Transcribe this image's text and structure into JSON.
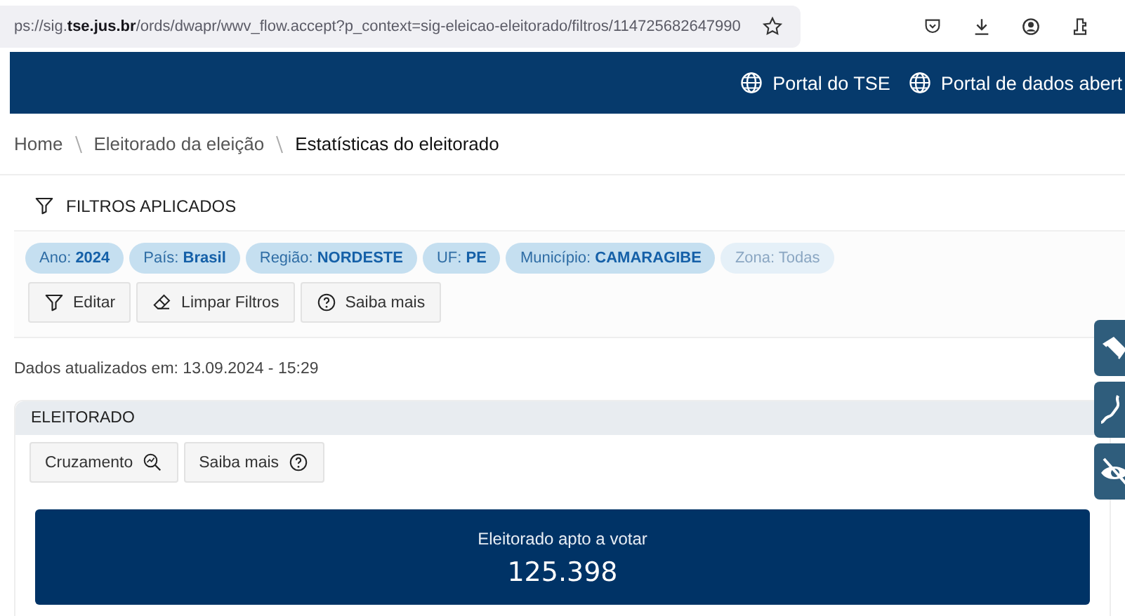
{
  "browser": {
    "url": "ps://sig.**tse.jus.br**/ords/dwapr/wwv_flow.accept?p_context=sig-eleicao-eleitorado/filtros/114725682647990"
  },
  "header": {
    "links": [
      "Portal do TSE",
      "Portal de dados abert"
    ]
  },
  "breadcrumb": [
    {
      "label": "Home",
      "current": false
    },
    {
      "label": "Eleitorado da eleição",
      "current": false
    },
    {
      "label": "Estatísticas do eleitorado",
      "current": true
    }
  ],
  "filters": {
    "title": "FILTROS APLICADOS",
    "chips": [
      {
        "text": "Ano: **2024**",
        "applied": true
      },
      {
        "text": "País: **Brasil**",
        "applied": true
      },
      {
        "text": "Região: **NORDESTE**",
        "applied": true
      },
      {
        "text": "UF: **PE**",
        "applied": true
      },
      {
        "text": "Município: **CAMARAGIBE**",
        "applied": true
      },
      {
        "text": "Zona: Todas",
        "applied": false
      }
    ],
    "buttons": [
      {
        "kind": "filter",
        "label": "Editar"
      },
      {
        "kind": "eraser",
        "label": "Limpar Filtros"
      },
      {
        "kind": "help",
        "label": "Saiba mais"
      }
    ]
  },
  "updated": "Dados atualizados em: 13.09.2024 - 15:29",
  "panel": {
    "title": "ELEITORADO",
    "buttons": [
      {
        "kind": "zoom",
        "label": "Cruzamento"
      },
      {
        "kind": "help",
        "label": "Saiba mais"
      }
    ],
    "stat": {
      "label": "Eleitorado apto a votar",
      "value": "125.398"
    }
  }
}
